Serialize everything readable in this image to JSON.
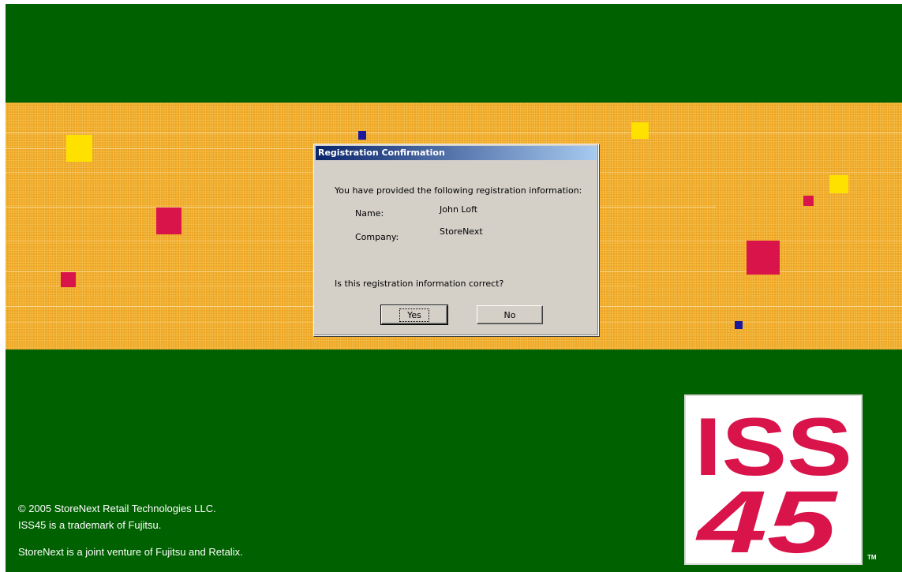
{
  "dialog": {
    "title": "Registration Confirmation",
    "intro": "You have provided the following registration information:",
    "fields": [
      {
        "label": "Name:",
        "value": "John Loft"
      },
      {
        "label": "Company:",
        "value": "StoreNext"
      }
    ],
    "question": "Is this registration information correct?",
    "yes_label": "Yes",
    "no_label": "No"
  },
  "logo": {
    "line1": "ISS",
    "line2": "45",
    "trademark": "TM"
  },
  "footer": {
    "copyright": "© 2005 StoreNext Retail Technologies LLC.",
    "trademark_note": "ISS45 is a trademark of Fujitsu.",
    "venture_note": "StoreNext is a joint venture of Fujitsu and Retalix."
  },
  "colors": {
    "background_green": "#006100",
    "band_orange": "#f0aa28",
    "logo_red": "#d8144a",
    "square_yellow": "#ffe100",
    "square_blue": "#1c1a9c"
  }
}
